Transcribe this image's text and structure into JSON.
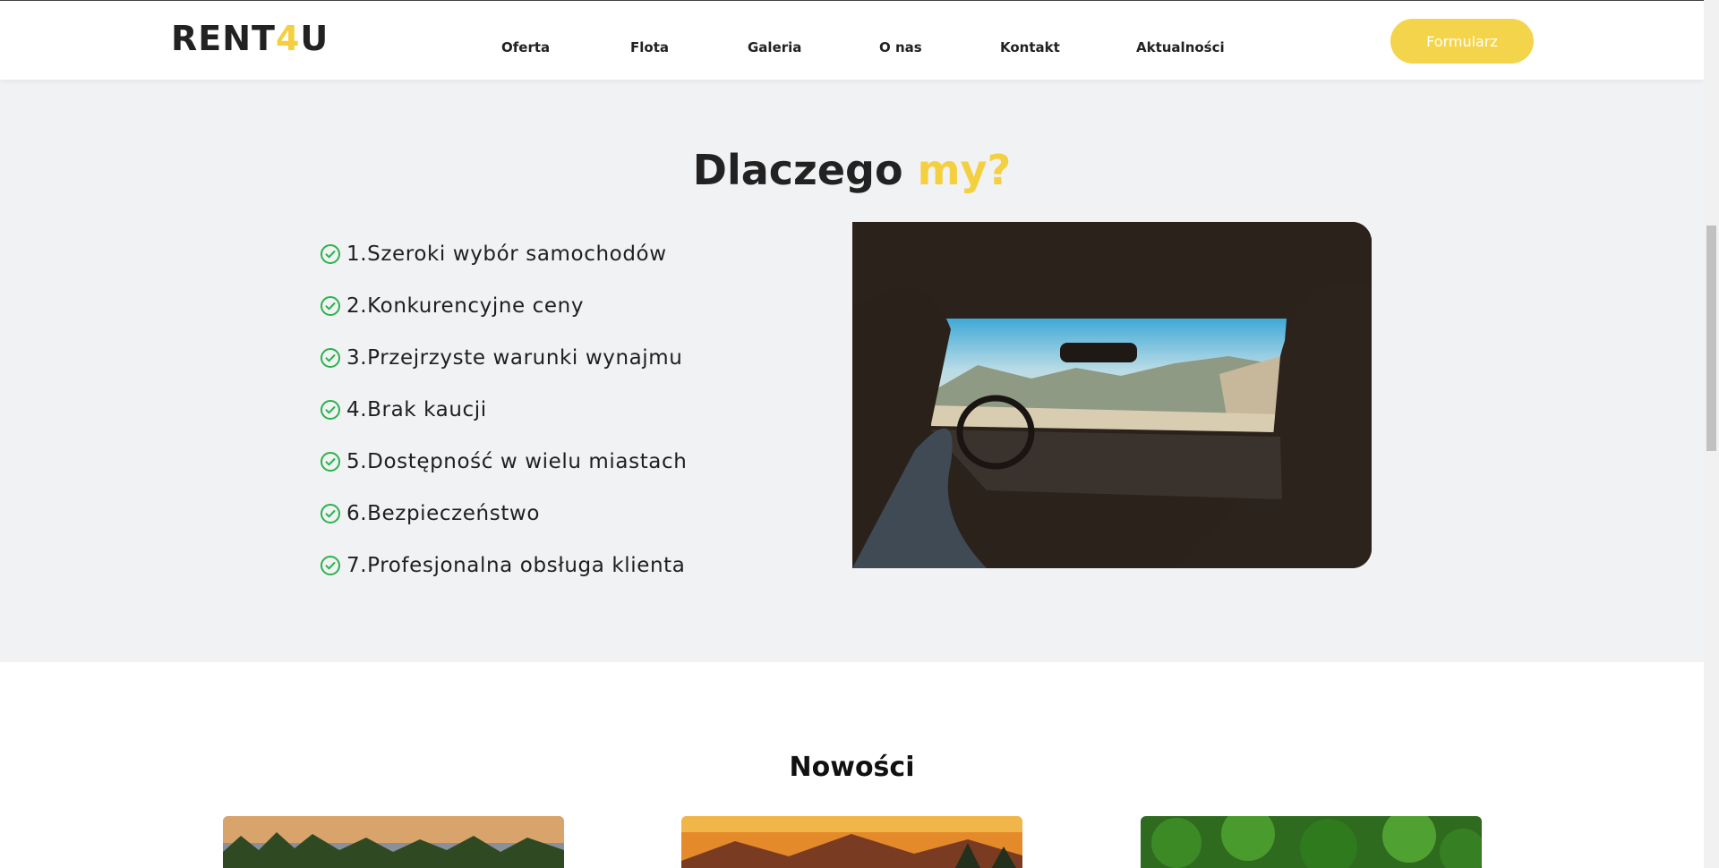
{
  "header": {
    "logo": {
      "part1": "RENT",
      "part2": "4",
      "part3": "U"
    },
    "nav": [
      "Oferta",
      "Flota",
      "Galeria",
      "O nas",
      "Kontakt",
      "Aktualności"
    ],
    "cta_label": "Formularz"
  },
  "why": {
    "title_main": "Dlaczego",
    "title_accent": "my?",
    "features": [
      "1.Szeroki wybór samochodów",
      "2.Konkurencyjne ceny",
      "3.Przejrzyste warunki wynajmu",
      "4.Brak kaucji",
      "5.Dostępność w wielu miastach",
      "6.Bezpieczeństwo",
      "7.Profesjonalna obsługa klienta"
    ]
  },
  "news": {
    "title": "Nowości"
  },
  "colors": {
    "accent": "#f4cf3f",
    "check": "#2bb24c",
    "cta": "#f4d44a"
  }
}
